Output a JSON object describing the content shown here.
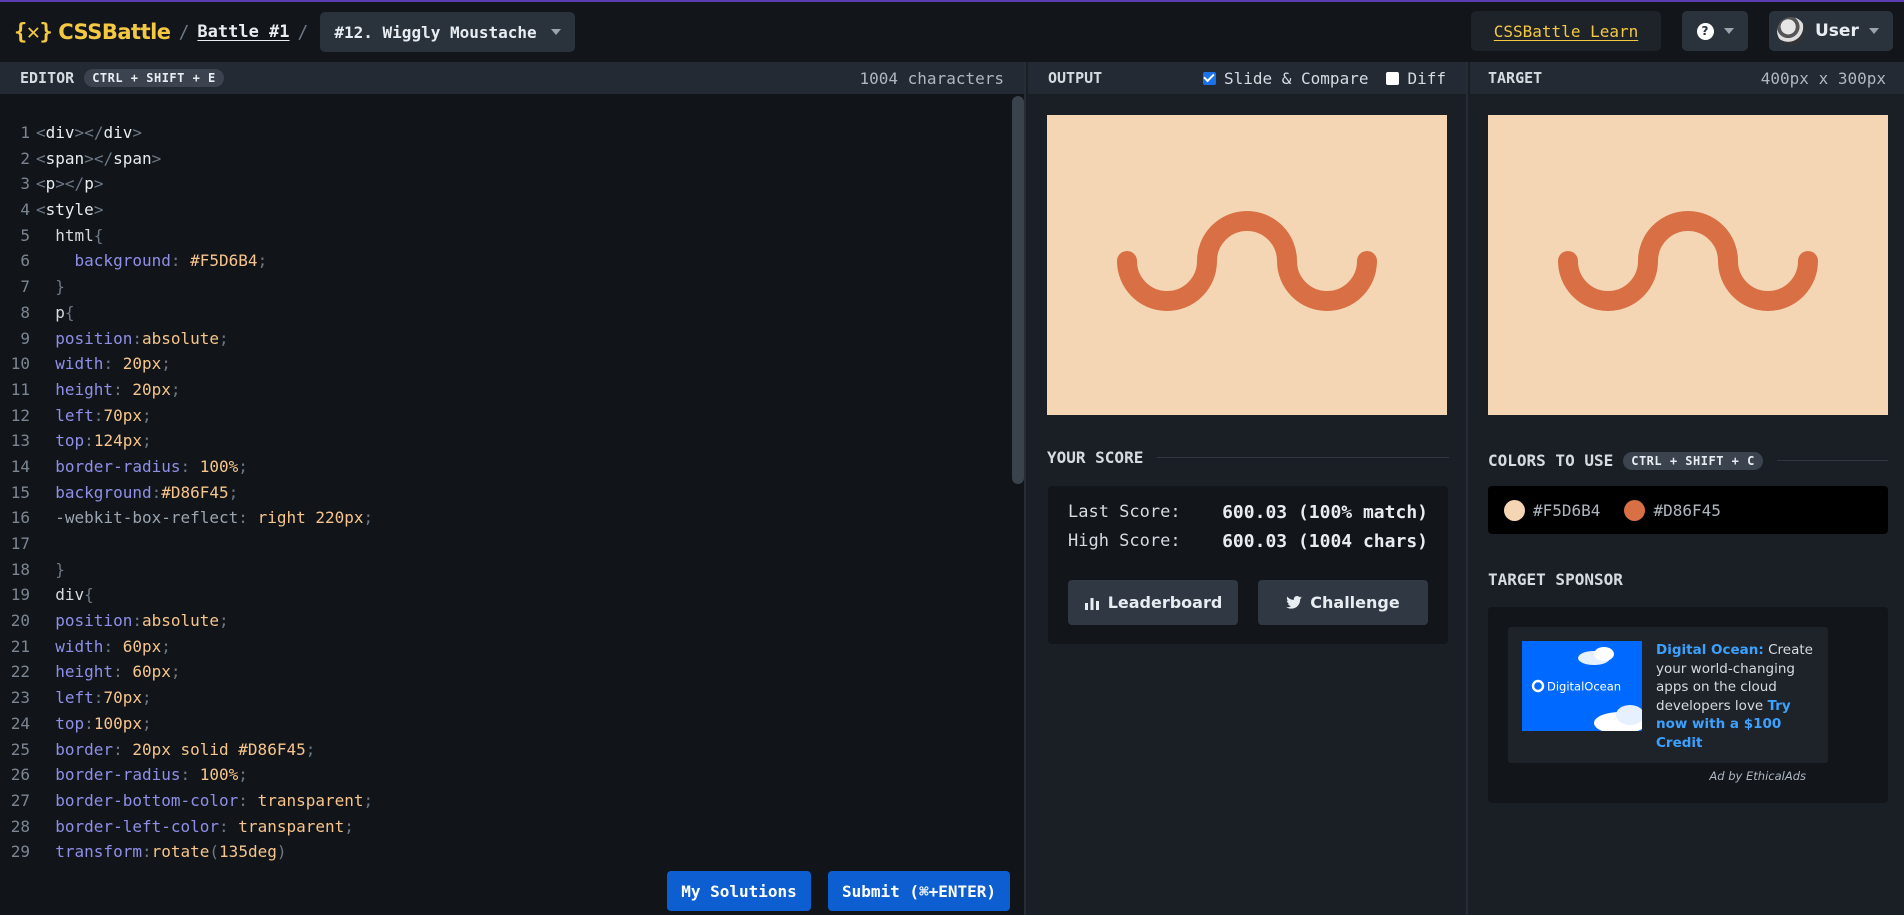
{
  "header": {
    "logo_text": "CSSBattle",
    "logo_mark": "{✕}",
    "breadcrumb_sep": "/",
    "battle_link": "Battle #1",
    "target_select": "#12. Wiggly Moustache",
    "learn_link": "CSSBattle Learn",
    "help_label": "?",
    "user_label": "User"
  },
  "editor": {
    "title": "EDITOR",
    "shortcut": "CTRL + SHIFT + E",
    "char_count": "1004 characters",
    "my_solutions": "My Solutions",
    "submit": "Submit (⌘+ENTER)",
    "lines": [
      "<div></div>",
      "<span></span>",
      "<p></p>",
      "<style>",
      "  html{",
      "    background: #F5D6B4;",
      "  }",
      "  p{",
      "  position:absolute;",
      "  width: 20px;",
      "  height: 20px;",
      "  left:70px;",
      "  top:124px;",
      "  border-radius: 100%;",
      "  background:#D86F45;",
      "  -webkit-box-reflect: right 220px;",
      "",
      "  }",
      "  div{",
      "  position:absolute;",
      "  width: 60px;",
      "  height: 60px;",
      "  left:70px;",
      "  top:100px;",
      "  border: 20px solid #D86F45;",
      "  border-radius: 100%;",
      "  border-bottom-color: transparent;",
      "  border-left-color: transparent;",
      "  transform:rotate(135deg)"
    ]
  },
  "output": {
    "title": "OUTPUT",
    "slide_compare_label": "Slide & Compare",
    "slide_compare_checked": true,
    "diff_label": "Diff",
    "diff_checked": false,
    "score_title": "YOUR SCORE",
    "last_score_label": "Last Score:",
    "last_score_value": "600.03 (100% match)",
    "high_score_label": "High Score:",
    "high_score_value": "600.03 (1004 chars)",
    "leaderboard_label": "Leaderboard",
    "challenge_label": "Challenge"
  },
  "target": {
    "title": "TARGET",
    "size": "400px x 300px",
    "colors_title": "COLORS TO USE",
    "colors_shortcut": "CTRL + SHIFT + C",
    "colors": [
      "#F5D6B4",
      "#D86F45"
    ],
    "sponsor_title": "TARGET SPONSOR",
    "ad_brand": "Digital Ocean:",
    "ad_body": "Create your world-changing apps on the cloud developers love",
    "ad_cta": "Try now with a $100 Credit",
    "ad_logo_text": "DigitalOcean",
    "ad_by": "Ad by EthicalAds"
  },
  "theme": {
    "background": "#F5D6B4",
    "shape": "#D86F45",
    "accent": "#f5c842",
    "primary_button": "#0d5fd1"
  }
}
